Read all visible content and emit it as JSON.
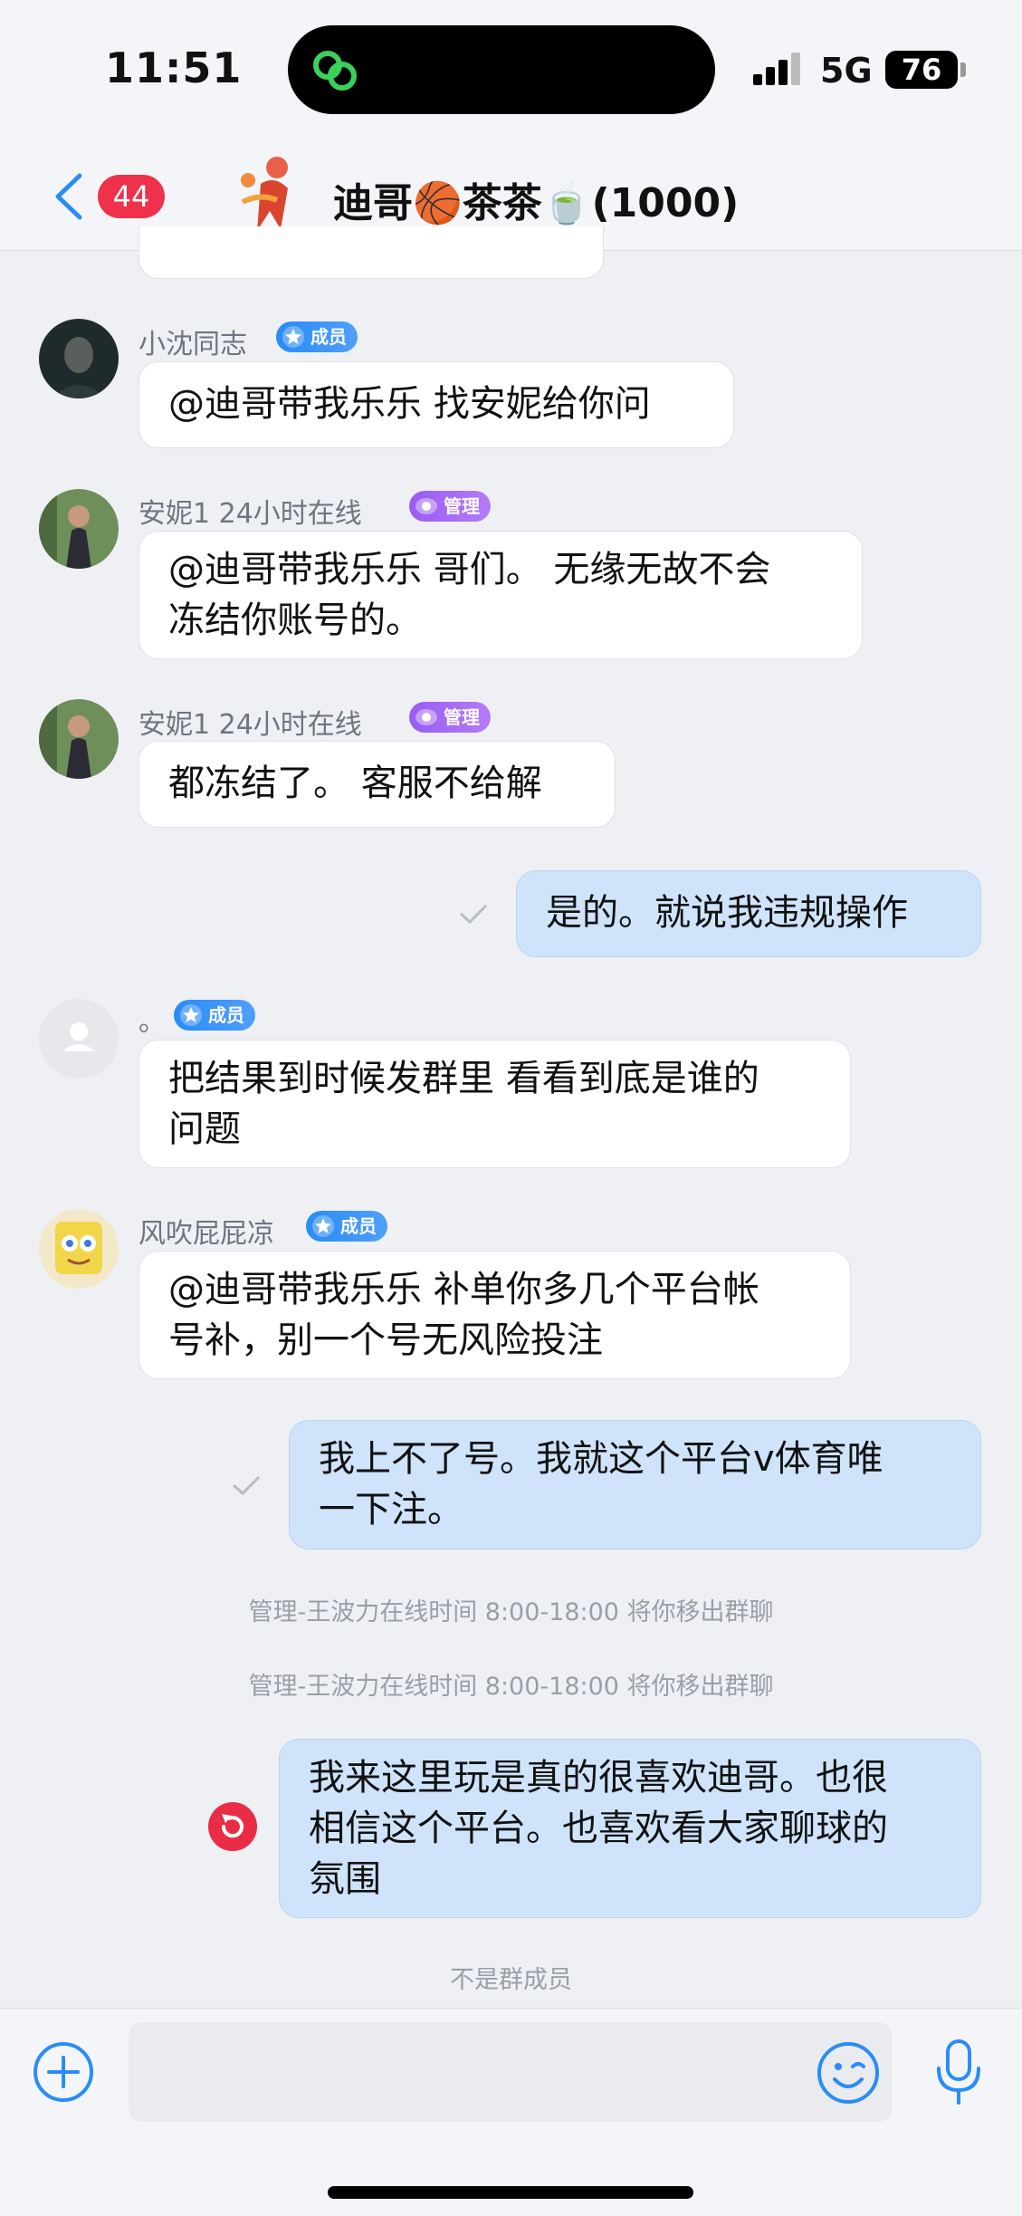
{
  "status_bar": {
    "time": "11:51",
    "network": "5G",
    "battery": "76"
  },
  "nav": {
    "unread_count": "44",
    "title": "迪哥🏀茶茶🍵(1000)"
  },
  "messages": [
    {
      "sender": "小沈同志",
      "tag": "成员",
      "text": "@迪哥带我乐乐 找安妮给你问"
    },
    {
      "sender": "安妮1 24小时在线",
      "tag": "管理",
      "text": "@迪哥带我乐乐 哥们。 无缘无故不会冻结你账号的。",
      "lines": [
        "@迪哥带我乐乐 哥们。 无缘无故不会",
        "冻结你账号的。"
      ]
    },
    {
      "sender": "安妮1 24小时在线",
      "tag": "管理",
      "text": "都冻结了。 客服不给解"
    },
    {
      "mine": true,
      "text": "是的。就说我违规操作"
    },
    {
      "sender": "。",
      "tag": "成员",
      "text": "把结果到时候发群里 看看到底是谁的问题",
      "lines": [
        "把结果到时候发群里 看看到底是谁的",
        "问题"
      ]
    },
    {
      "sender": "风吹屁屁凉",
      "tag": "成员",
      "text": "@迪哥带我乐乐 补单你多几个平台帐号补，别一个号无风险投注",
      "lines": [
        "@迪哥带我乐乐 补单你多几个平台帐",
        "号补，别一个号无风险投注"
      ]
    },
    {
      "mine": true,
      "text": "我上不了号。我就这个平台v体育唯一下注。",
      "lines": [
        "我上不了号。我就这个平台v体育唯",
        "一下注。"
      ]
    },
    {
      "mine": true,
      "text": "我来这里玩是真的很喜欢迪哥。也很相信这个平台。也喜欢看大家聊球的氛围",
      "lines": [
        "我来这里玩是真的很喜欢迪哥。也很",
        "相信这个平台。也喜欢看大家聊球的",
        "氛围"
      ]
    }
  ],
  "system_notices": [
    "管理-王波力在线时间 8:00-18:00 将你移出群聊",
    "管理-王波力在线时间 8:00-18:00 将你移出群聊",
    "不是群成员"
  ],
  "colors": {
    "accent": "#2a8cf6",
    "badge": "#f0314b",
    "mine_bubble": "#cfe4fb",
    "admin_tag": "#9a5cf2"
  },
  "icons": [
    "back-icon",
    "search-chat-icon",
    "plus-icon",
    "emoji-icon",
    "mic-icon",
    "retry-icon",
    "check-icon"
  ]
}
